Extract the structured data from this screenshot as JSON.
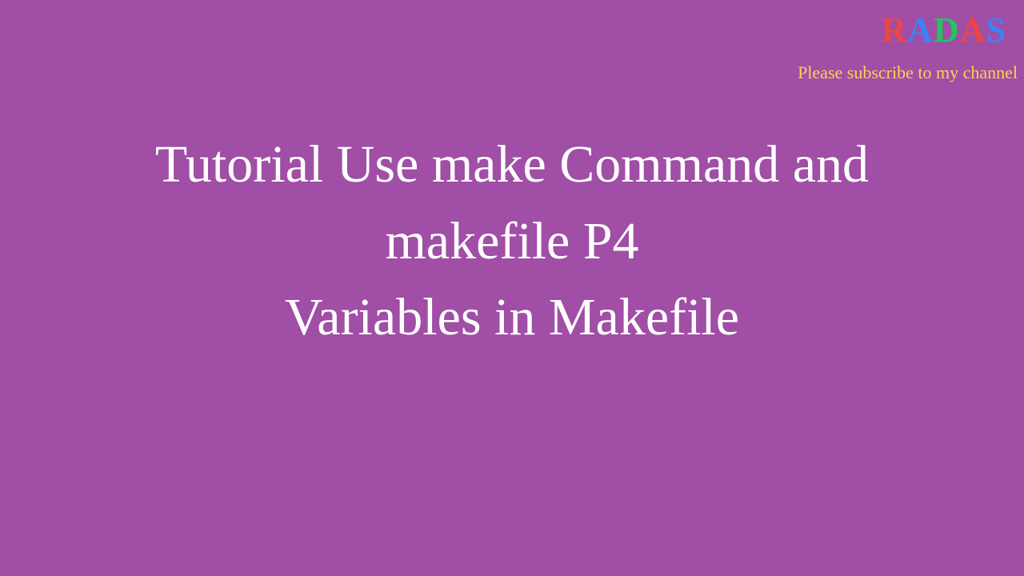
{
  "logo": {
    "letters": [
      "R",
      "A",
      "D",
      "A",
      "S"
    ],
    "colors": [
      "#ef4444",
      "#3b82f6",
      "#22c55e",
      "#ef4444",
      "#3b82f6"
    ]
  },
  "subscribe_text": "Please subscribe to my channel",
  "title": {
    "line1": "Tutorial Use make Command and",
    "line2": "makefile P4",
    "line3": "Variables in Makefile"
  }
}
